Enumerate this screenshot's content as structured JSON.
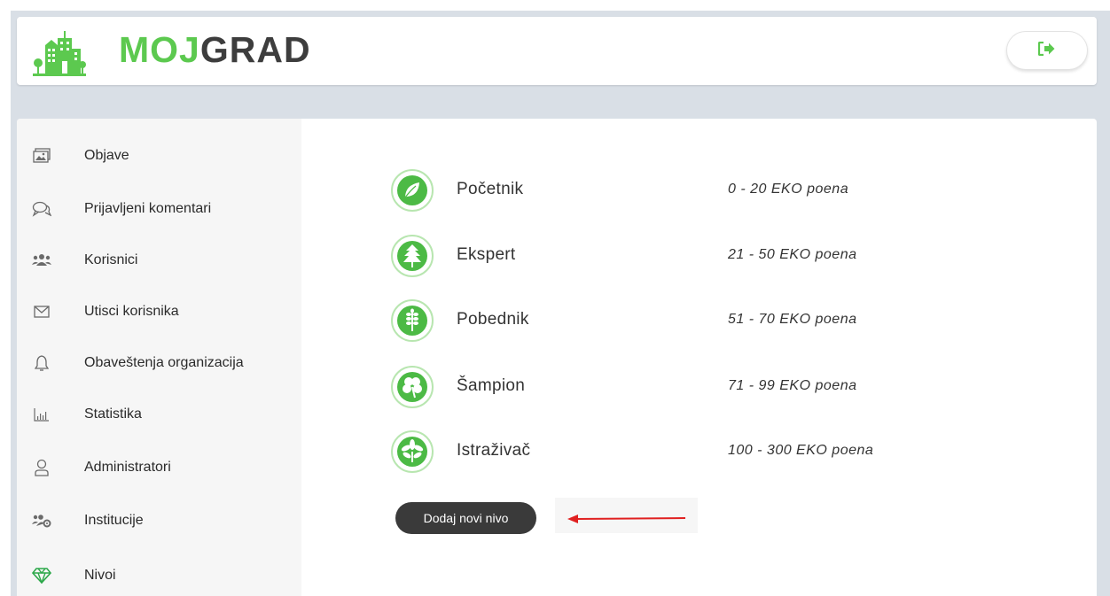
{
  "app": {
    "logo_part1": "MOJ",
    "logo_part2": "GRAD",
    "logout_icon": "sign-out-icon",
    "brand_green": "#5cc94f"
  },
  "sidebar": {
    "items": [
      {
        "label": "Objave",
        "icon": "image-icon"
      },
      {
        "label": "Prijavljeni komentari",
        "icon": "comments-icon"
      },
      {
        "label": "Korisnici",
        "icon": "users-icon"
      },
      {
        "label": "Utisci korisnika",
        "icon": "envelope-icon"
      },
      {
        "label": "Obaveštenja organizacija",
        "icon": "bell-icon"
      },
      {
        "label": "Statistika",
        "icon": "bar-chart-icon"
      },
      {
        "label": "Administratori",
        "icon": "user-icon"
      },
      {
        "label": "Institucije",
        "icon": "users-gear-icon"
      },
      {
        "label": "Nivoi",
        "icon": "diamond-icon"
      }
    ]
  },
  "levels": [
    {
      "name": "Početnik",
      "range": "0 - 20 EKO poena",
      "icon": "leaf-icon"
    },
    {
      "name": "Ekspert",
      "range": "21 - 50 EKO poena",
      "icon": "fern-leaf-icon"
    },
    {
      "name": "Pobednik",
      "range": "51 - 70 EKO poena",
      "icon": "wheat-icon"
    },
    {
      "name": "Šampion",
      "range": "71 - 99 EKO poena",
      "icon": "clover-icon"
    },
    {
      "name": "Istraživač",
      "range": "100 - 300 EKO poena",
      "icon": "chestnut-leaf-icon"
    }
  ],
  "actions": {
    "add_level_label": "Dodaj novi nivo",
    "arrow_color": "#e02020"
  }
}
